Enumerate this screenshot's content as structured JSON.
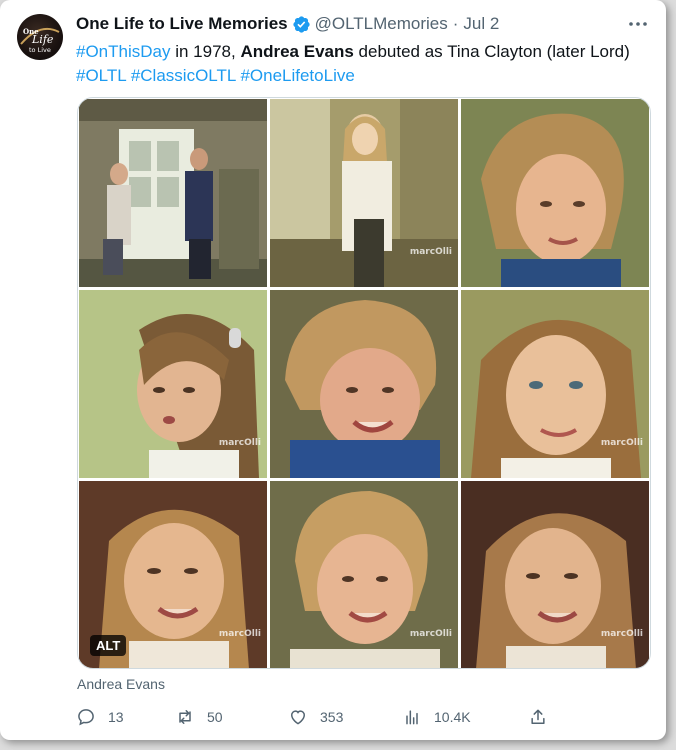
{
  "tweet": {
    "display_name": "One Life to Live Memories",
    "handle": "@OLTLMemories",
    "separator": "·",
    "date": "Jul 2",
    "avatar_logo_text": [
      "One",
      "Life",
      "to Live"
    ],
    "text": {
      "hashtag1": "#OnThisDay",
      "part1": " in 1978, ",
      "name": "Andrea Evans",
      "part2": " debuted as Tina Clayton (later Lord)",
      "hashtag2": "#OLTL",
      "hashtag3": "#ClassicOLTL",
      "hashtag4": "#OneLifetoLive"
    },
    "media": {
      "watermark": "marcOlli",
      "alt_label": "ALT",
      "caption": "Andrea Evans"
    },
    "actions": {
      "replies": "13",
      "reposts": "50",
      "likes": "353",
      "views": "10.4K"
    }
  },
  "colors": {
    "link": "#1d9bf0",
    "verified": "#1d9bf0",
    "secondary_text": "#536471",
    "border": "#cfd9de"
  },
  "icons": [
    "more-icon",
    "verified-badge-icon",
    "reply-icon",
    "repost-icon",
    "like-icon",
    "views-icon",
    "share-icon"
  ]
}
